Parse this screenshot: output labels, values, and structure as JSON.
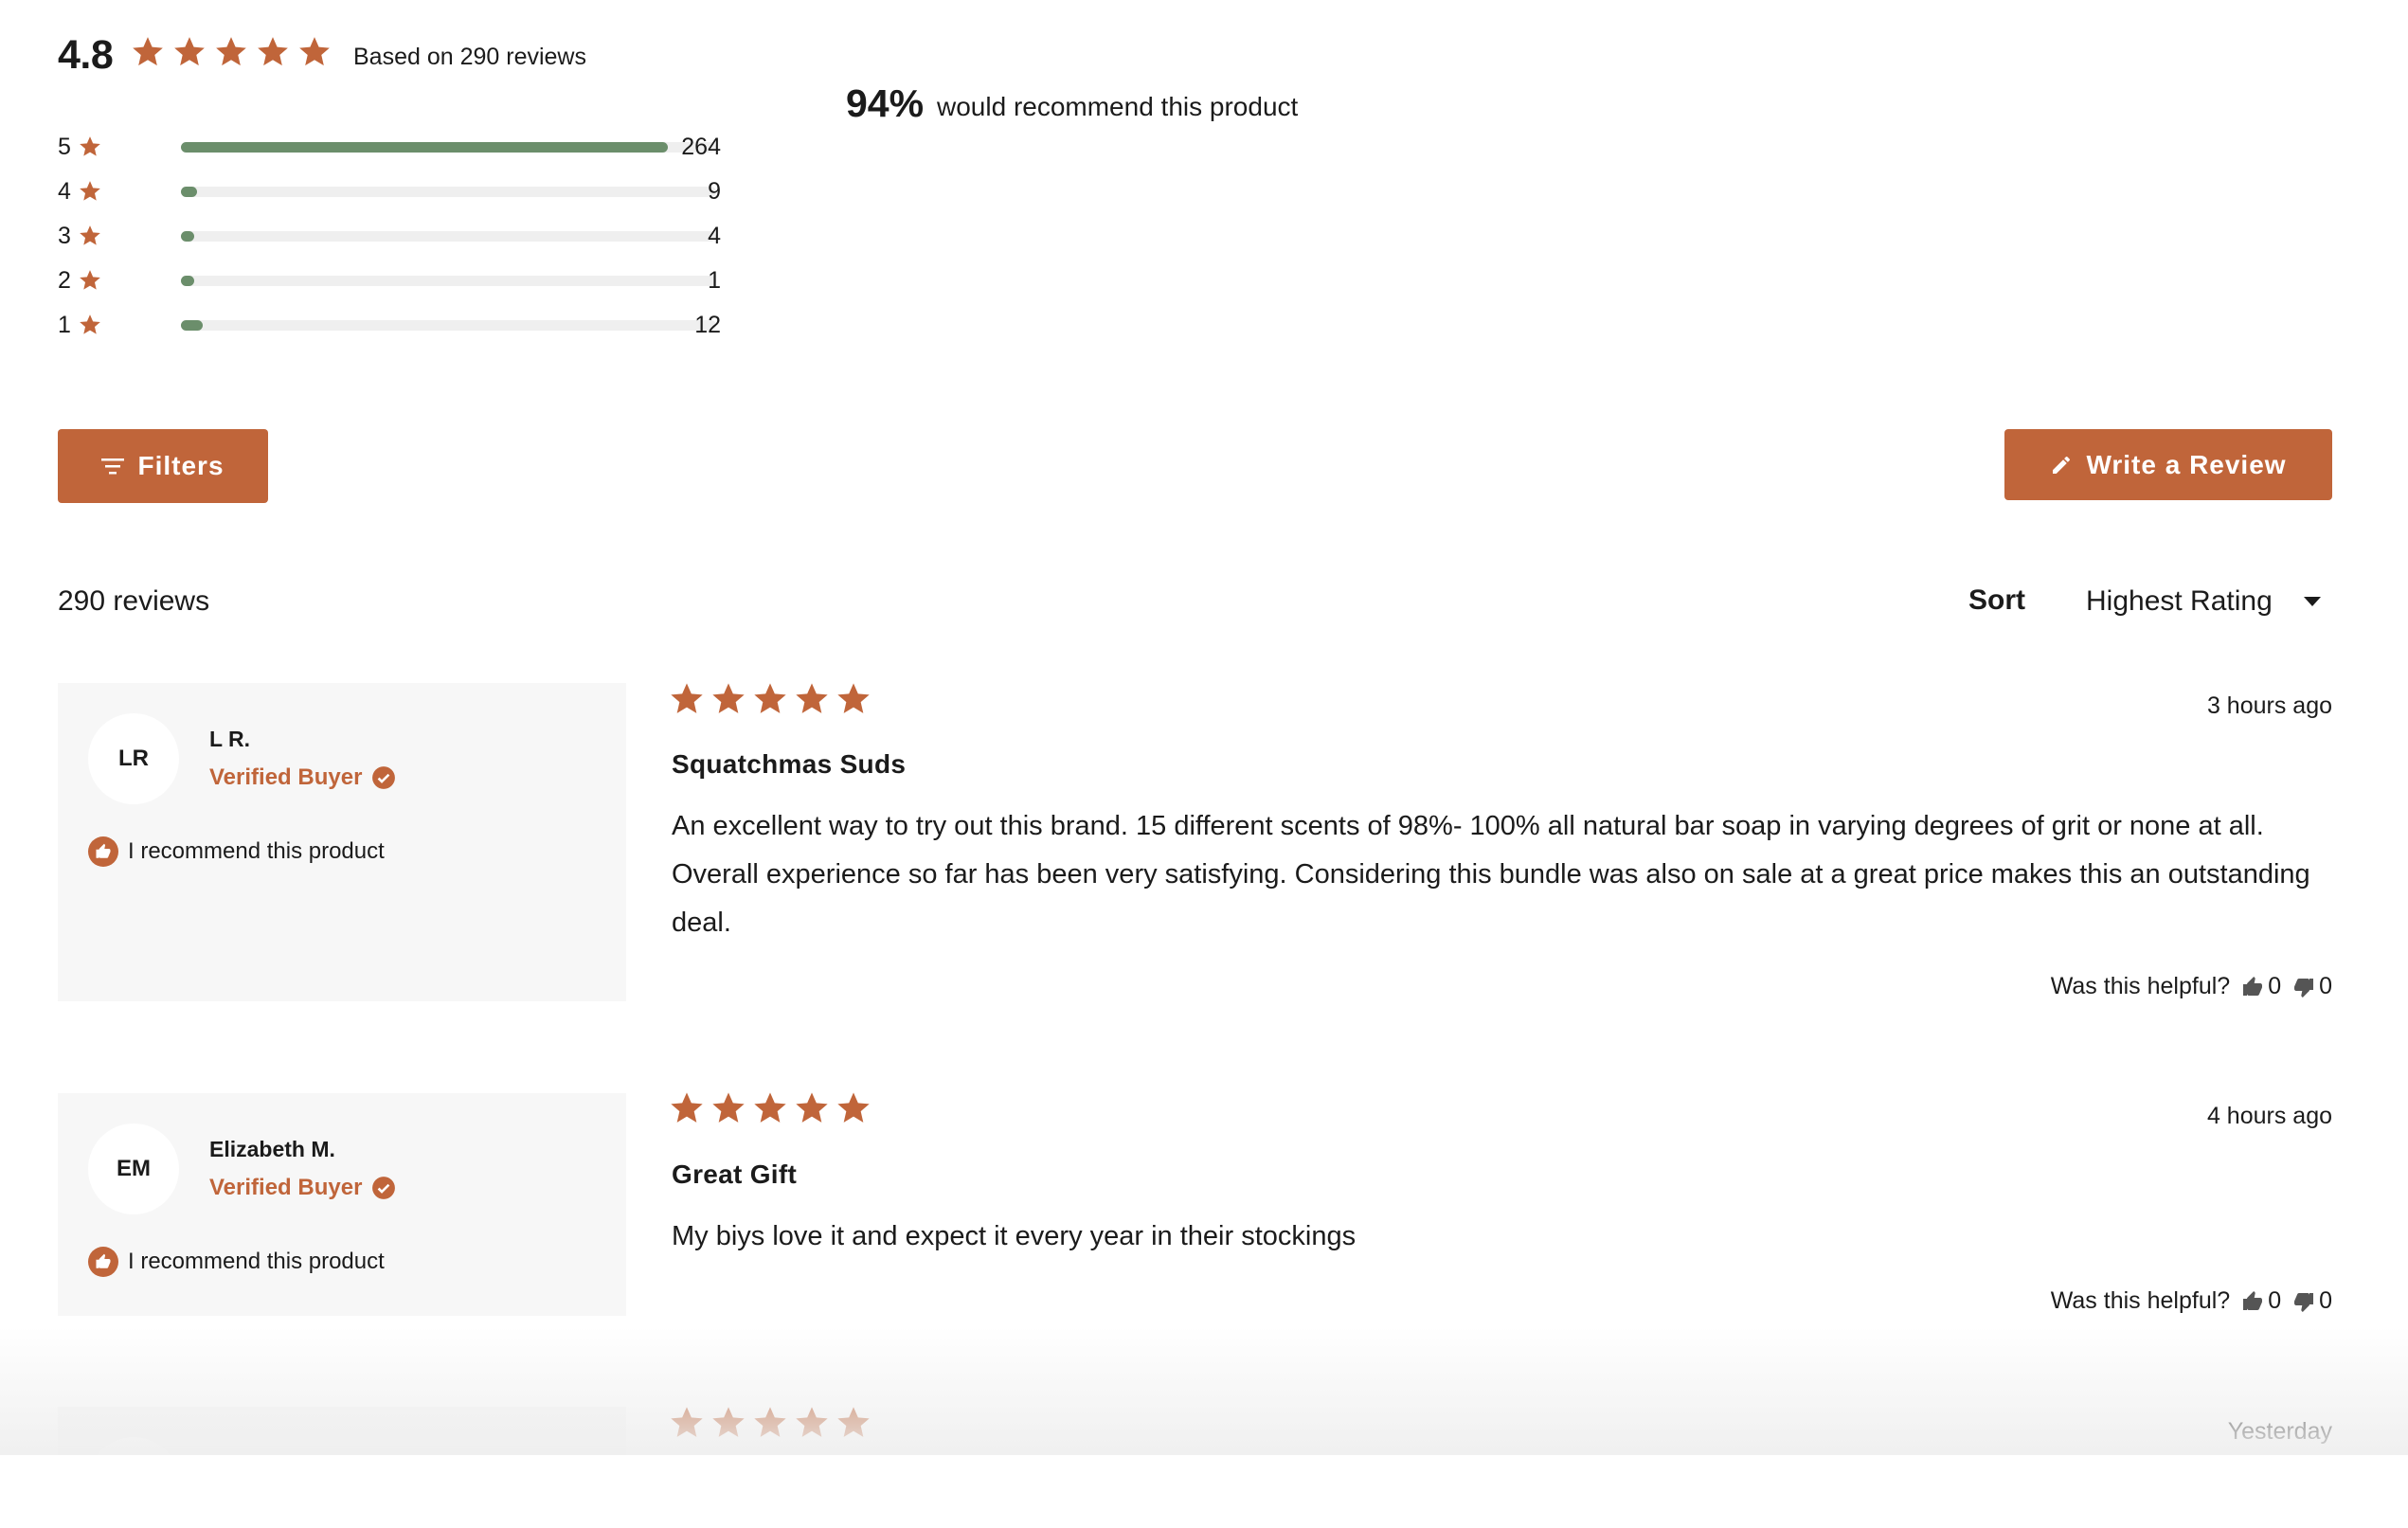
{
  "summary": {
    "average": "4.8",
    "stars": 4.8,
    "based_on": "Based on 290 reviews",
    "recommend_pct": "94%",
    "recommend_text": "would recommend this product",
    "histogram": [
      {
        "stars": "5",
        "count": "264",
        "fraction": 0.91
      },
      {
        "stars": "4",
        "count": "9",
        "fraction": 0.03
      },
      {
        "stars": "3",
        "count": "4",
        "fraction": 0.015
      },
      {
        "stars": "2",
        "count": "1",
        "fraction": 0.01
      },
      {
        "stars": "1",
        "count": "12",
        "fraction": 0.04
      }
    ]
  },
  "toolbar": {
    "filters_label": "Filters",
    "write_label": "Write a Review",
    "review_count": "290 reviews",
    "sort_label": "Sort",
    "sort_value": "Highest Rating"
  },
  "reviews": [
    {
      "initials": "LR",
      "name": "L R.",
      "verified": "Verified Buyer",
      "recommend": "I recommend this product",
      "rating": 5,
      "date": "3 hours ago",
      "title": "Squatchmas Suds",
      "body": "An excellent way to try out this brand. 15 different scents of 98%- 100% all natural bar soap in varying degrees of grit or none at all. Overall experience so far has been very satisfying. Considering this bundle was also on sale at a great price makes this an outstanding deal.",
      "helpful_label": "Was this helpful?",
      "up": "0",
      "down": "0"
    },
    {
      "initials": "EM",
      "name": "Elizabeth M.",
      "verified": "Verified Buyer",
      "recommend": "I recommend this product",
      "rating": 5,
      "date": "4 hours ago",
      "title": "Great Gift",
      "body": "My biys love it and expect it every year in their stockings",
      "helpful_label": "Was this helpful?",
      "up": "0",
      "down": "0"
    },
    {
      "rating": 5,
      "date": "Yesterday"
    }
  ],
  "colors": {
    "accent": "#c0653a",
    "bar_fill": "#6b8e6b",
    "bar_track": "#efefef",
    "card_bg": "#f7f7f7"
  },
  "icons": [
    "star-icon",
    "filter-icon",
    "pencil-icon",
    "check-badge-icon",
    "thumbs-up-icon",
    "thumbs-down-icon",
    "caret-down-icon"
  ]
}
